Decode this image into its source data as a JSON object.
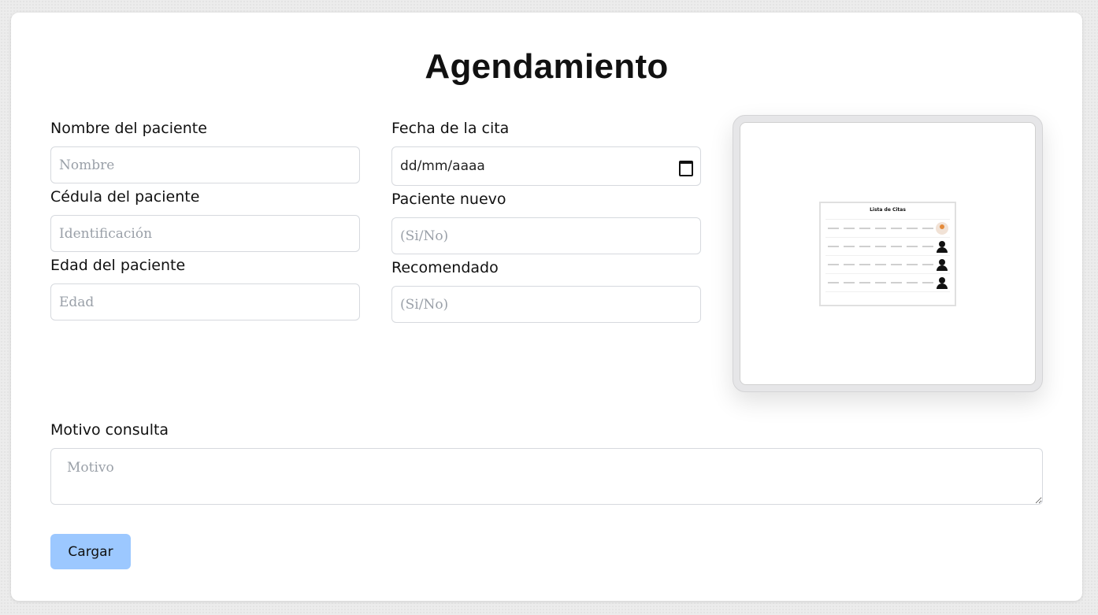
{
  "title": "Agendamiento",
  "form": {
    "nombre_label": "Nombre del paciente",
    "nombre_placeholder": "Nombre",
    "cedula_label": "Cédula del paciente",
    "cedula_placeholder": "Identificación",
    "edad_label": "Edad del paciente",
    "edad_placeholder": "Edad",
    "fecha_label": "Fecha de la cita",
    "fecha_value": "dd/mm/aaaa",
    "nuevo_label": "Paciente nuevo",
    "nuevo_placeholder": "(Si/No)",
    "recomendado_label": "Recomendado",
    "recomendado_placeholder": "(Si/No)",
    "motivo_label": "Motivo consulta",
    "motivo_placeholder": "Motivo",
    "submit_label": "Cargar"
  },
  "preview": {
    "title": "Lista de Citas",
    "icon": "calendar-icon"
  },
  "colors": {
    "button": "#9cc8ff",
    "background": "#ececec",
    "card": "#ffffff"
  }
}
